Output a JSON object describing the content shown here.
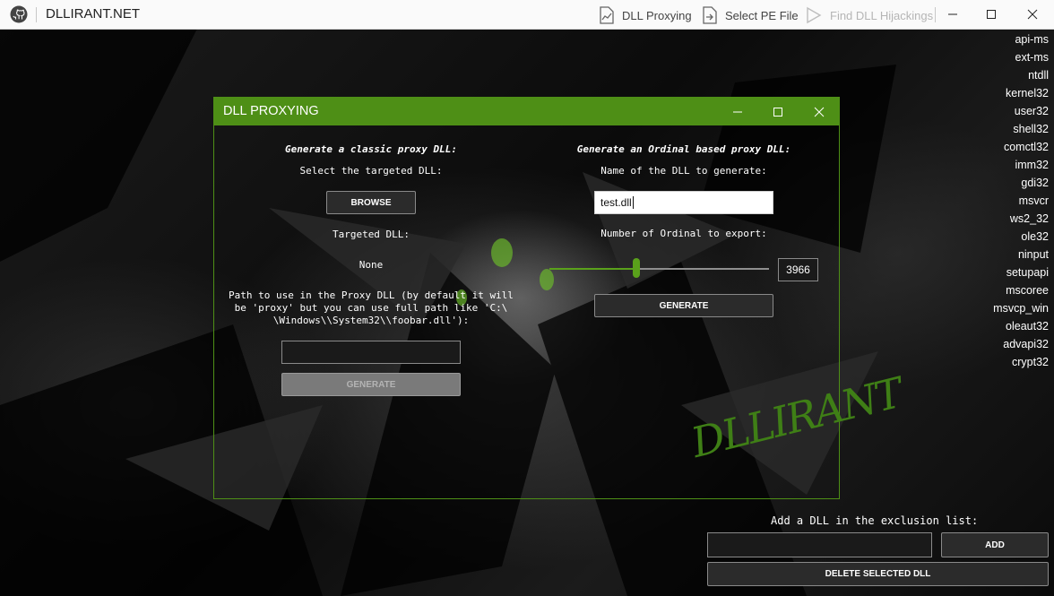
{
  "app": {
    "title": "DLLIRANT.NET"
  },
  "toolbar": {
    "proxy_label": "DLL Proxying",
    "select_pe_label": "Select PE File",
    "find_hijack_label": "Find DLL Hijackings"
  },
  "dll_list": [
    "api-ms",
    "ext-ms",
    "ntdll",
    "kernel32",
    "user32",
    "shell32",
    "comctl32",
    "imm32",
    "gdi32",
    "msvcr",
    "ws2_32",
    "ole32",
    "ninput",
    "setupapi",
    "mscoree",
    "msvcp_win",
    "oleaut32",
    "advapi32",
    "crypt32"
  ],
  "exclusion": {
    "label": "Add a DLL in the exclusion list:",
    "input_value": "",
    "add_label": "ADD",
    "delete_label": "DELETE SELECTED DLL"
  },
  "dialog": {
    "title": "DLL PROXYING",
    "classic": {
      "heading": "Generate a classic proxy DLL:",
      "select_label": "Select the targeted DLL:",
      "browse_label": "BROWSE",
      "targeted_label": "Targeted DLL:",
      "targeted_value": "None",
      "path_line1": "Path to use in the Proxy DLL (by default it will",
      "path_line2": "be 'proxy' but you can use full path like 'C:\\",
      "path_line3": "\\Windows\\\\System32\\\\foobar.dll'):",
      "path_value": "",
      "generate_label": "GENERATE"
    },
    "ordinal": {
      "heading": "Generate an Ordinal based proxy DLL:",
      "name_label": "Name of the DLL to generate:",
      "name_value": "test.dll",
      "count_label": "Number of Ordinal to export:",
      "count_value": "3966",
      "slider_fraction": 0.395,
      "generate_label": "GENERATE"
    }
  },
  "watermark": {
    "text": "DLLIRANT"
  },
  "colors": {
    "accent": "#4e8f16",
    "slider": "#5aa11b"
  }
}
